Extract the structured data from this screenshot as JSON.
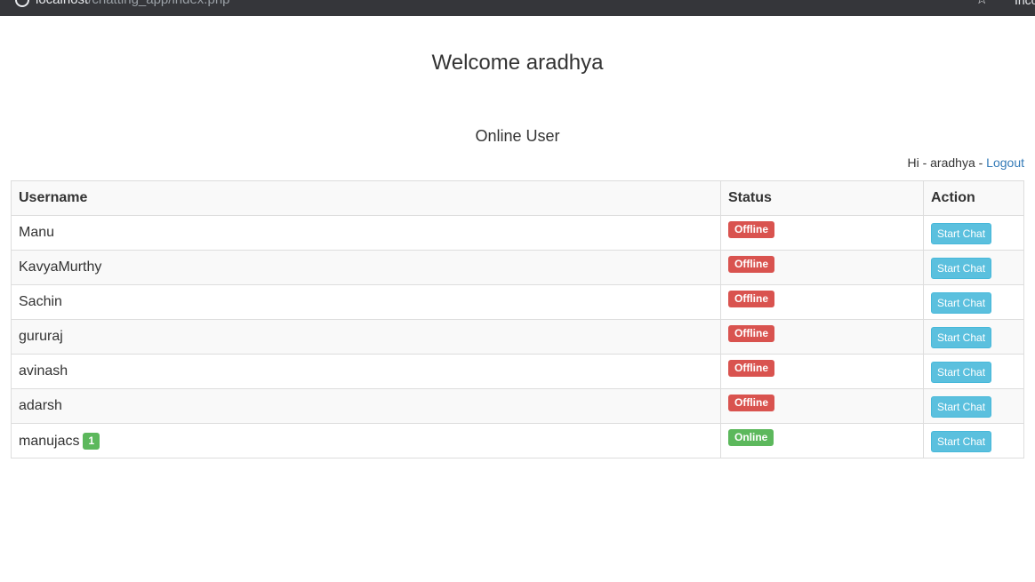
{
  "browser": {
    "url_host": "localhost",
    "url_path": "/chatting_app/index.php",
    "profile_text": "Inco"
  },
  "page": {
    "welcome": "Welcome aradhya",
    "section_title": "Online User",
    "greeting": "Hi - aradhya - ",
    "logout_label": "Logout"
  },
  "table": {
    "headers": [
      "Username",
      "Status",
      "Action"
    ],
    "rows": [
      {
        "username": "Manu",
        "status": "Offline",
        "action": "Start Chat"
      },
      {
        "username": "KavyaMurthy",
        "status": "Offline",
        "action": "Start Chat"
      },
      {
        "username": "Sachin",
        "status": "Offline",
        "action": "Start Chat"
      },
      {
        "username": "gururaj",
        "status": "Offline",
        "action": "Start Chat"
      },
      {
        "username": "avinash",
        "status": "Offline",
        "action": "Start Chat"
      },
      {
        "username": "adarsh",
        "status": "Offline",
        "action": "Start Chat"
      },
      {
        "username": "manujacs",
        "status": "Online",
        "action": "Start Chat",
        "unread": "1"
      }
    ]
  },
  "colors": {
    "offline": "#d9534f",
    "online": "#5cb85c",
    "button": "#5bc0de",
    "link": "#337ab7"
  },
  "icons": {
    "address_info": "info-icon",
    "bookmark": "star-icon"
  }
}
